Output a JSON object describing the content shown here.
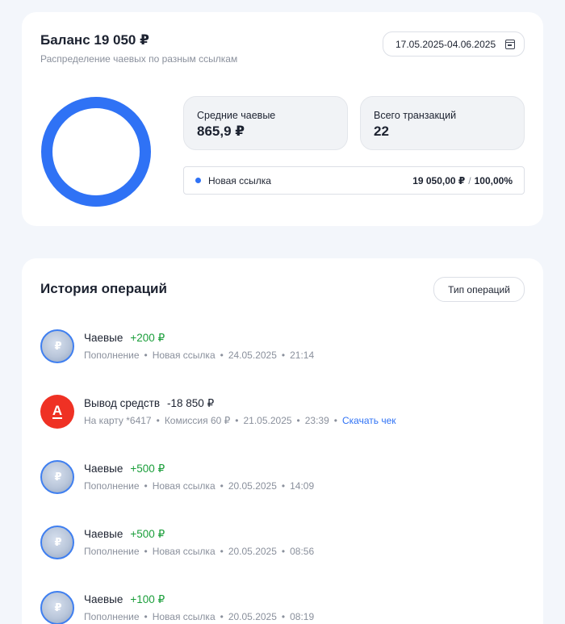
{
  "balance": {
    "title": "Баланс 19 050 ₽",
    "subtitle": "Распределение чаевых по разным ссылкам",
    "date_range": "17.05.2025-04.06.2025",
    "date_icon": "calendar-icon",
    "donut": {
      "share": 1.0,
      "color": "#2f72f5"
    },
    "stats": [
      {
        "label": "Средние чаевые",
        "value": "865,9 ₽"
      },
      {
        "label": "Всего транзакций",
        "value": "22"
      }
    ],
    "legend": {
      "name": "Новая ссылка",
      "amount": "19 050,00 ₽",
      "separator": "/",
      "percent": "100,00%",
      "color": "#2f72f5"
    }
  },
  "history": {
    "title": "История операций",
    "filter_label": "Тип операций",
    "separator": "•",
    "operations": [
      {
        "title": "Чаевые",
        "amount": "+200 ₽",
        "meta": [
          "Пополнение",
          "Новая ссылка",
          "24.05.2025",
          "21:14"
        ]
      },
      {
        "title": "Вывод средств",
        "amount": "-18 850 ₽",
        "meta": [
          "На карту *6417",
          "Комиссия 60 ₽",
          "21.05.2025",
          "23:39"
        ],
        "link": "Скачать чек",
        "bank_letter": "А"
      },
      {
        "title": "Чаевые",
        "amount": "+500 ₽",
        "meta": [
          "Пополнение",
          "Новая ссылка",
          "20.05.2025",
          "14:09"
        ]
      },
      {
        "title": "Чаевые",
        "amount": "+500 ₽",
        "meta": [
          "Пополнение",
          "Новая ссылка",
          "20.05.2025",
          "08:56"
        ]
      },
      {
        "title": "Чаевые",
        "amount": "+100 ₽",
        "meta": [
          "Пополнение",
          "Новая ссылка",
          "20.05.2025",
          "08:19"
        ]
      }
    ],
    "coin_icon": "coin-icon",
    "coin_glyph": "₽",
    "bank_icon": "alfa-bank-icon",
    "colors": {
      "positive": "#1a9e3a",
      "link": "#2f72f5",
      "bank": "#ef3124"
    }
  }
}
